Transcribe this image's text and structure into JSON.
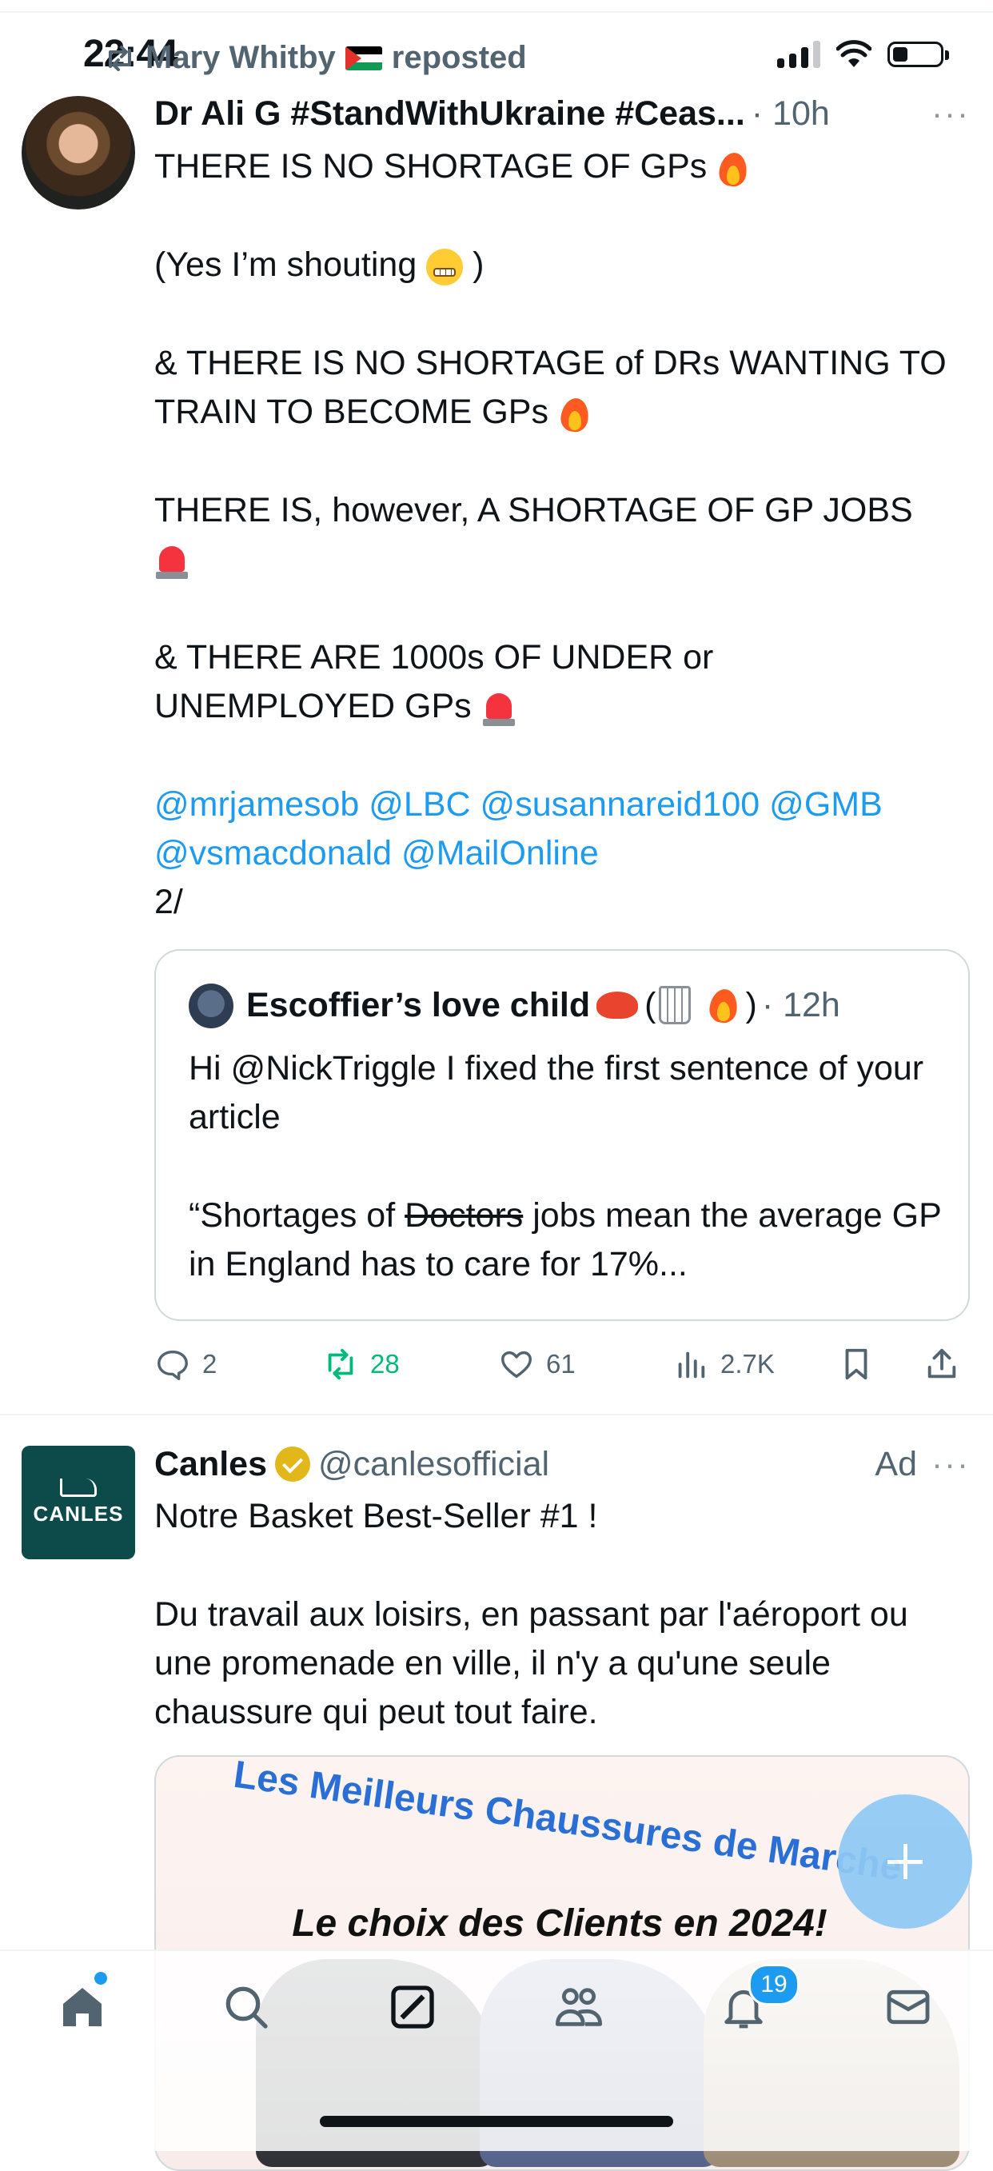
{
  "status_bar": {
    "time": "22:44"
  },
  "tweet": {
    "repost_label": "Mary Whitby",
    "repost_suffix": "reposted",
    "author_name": "Dr Ali G #StandWithUkraine #Ceas...",
    "time_ago": "10h",
    "paragraphs": [
      "THERE IS NO SHORTAGE OF GPs",
      "(Yes I’m shouting",
      ")",
      "& THERE IS NO SHORTAGE of DRs WANTING TO TRAIN TO BECOME GPs",
      "THERE IS, however, A SHORTAGE OF GP JOBS",
      "& THERE ARE 1000s OF UNDER or UNEMPLOYED GPs"
    ],
    "mentions": [
      "@mrjamesob",
      "@LBC",
      "@susannareid100",
      "@GMB",
      "@vsmacdonald",
      "@MailOnline"
    ],
    "suffix": "2/",
    "quote": {
      "author_name": "Escoffier’s love child",
      "open_paren": "(",
      "close_paren": ")",
      "time_ago": "12h",
      "line1": "Hi @NickTriggle I fixed the first sentence of your article",
      "line2_a": "“Shortages of",
      "line2_struck": "Doctors",
      "line2_b": "jobs mean the average GP in England has to care for 17%..."
    },
    "actions": {
      "replies": "2",
      "reposts": "28",
      "likes": "61",
      "views": "2.7K"
    }
  },
  "ad": {
    "avatar_text": "CANLES",
    "name": "Canles",
    "handle": "@canlesofficial",
    "label": "Ad",
    "paragraphs": [
      "Notre Basket Best-Seller #1 !",
      "Du travail aux loisirs, en passant par l'aéroport ou une promenade en ville, il n'y a qu'une seule chaussure qui peut tout faire."
    ],
    "media_title": "Les Meilleurs Chaussures de Marche",
    "media_subtitle": "Le choix des Clients en 2024!"
  },
  "nav": {
    "notifications_badge": "19"
  },
  "colors": {
    "link": "#1d9bf0",
    "repost_green": "#00ba7c",
    "secondary_text": "#536471"
  }
}
